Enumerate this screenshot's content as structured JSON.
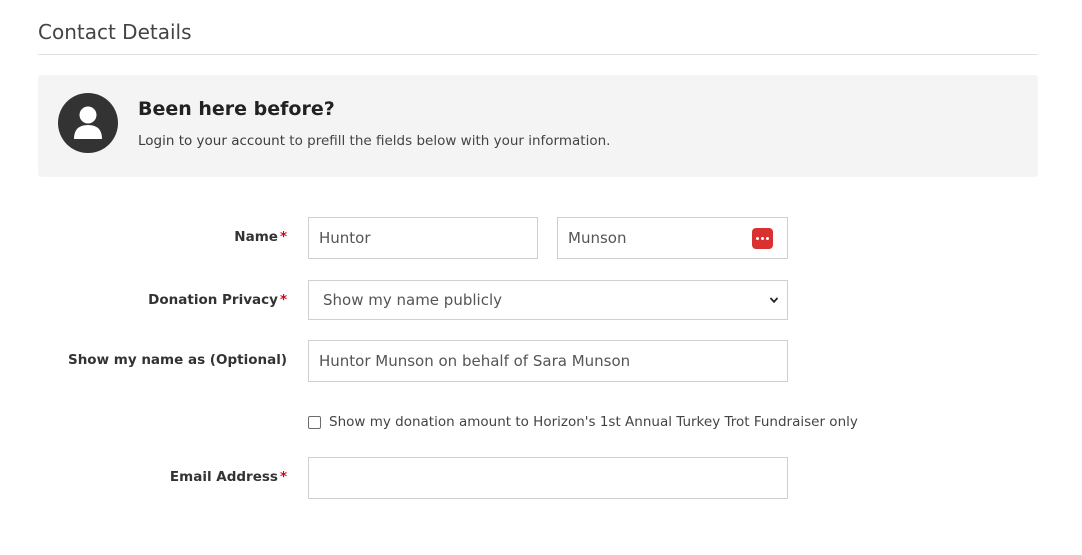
{
  "section": {
    "title": "Contact Details"
  },
  "login_panel": {
    "heading": "Been here before?",
    "link_text": "Login to your account",
    "rest_text": " to prefill the fields below with your information."
  },
  "form": {
    "required_mark": "*",
    "name": {
      "label": "Name",
      "first_value": "Huntor",
      "last_value": "Munson"
    },
    "privacy": {
      "label": "Donation Privacy",
      "selected": "Show my name publicly"
    },
    "display_name": {
      "label": "Show my name as (Optional)",
      "value": "Huntor Munson on behalf of Sara Munson"
    },
    "amount_checkbox": {
      "label": "Show my donation amount to Horizon's 1st Annual Turkey Trot Fundraiser only",
      "checked": false
    },
    "email": {
      "label": "Email Address",
      "value": ""
    }
  },
  "icons": {
    "avatar": "user-avatar-icon",
    "password_manager": "password-manager-icon",
    "select_arrow": "chevron-down-icon"
  },
  "colors": {
    "required": "#d0021b",
    "panel_background": "#f4f4f4",
    "avatar_background": "#333333",
    "password_icon": "#d93131"
  }
}
